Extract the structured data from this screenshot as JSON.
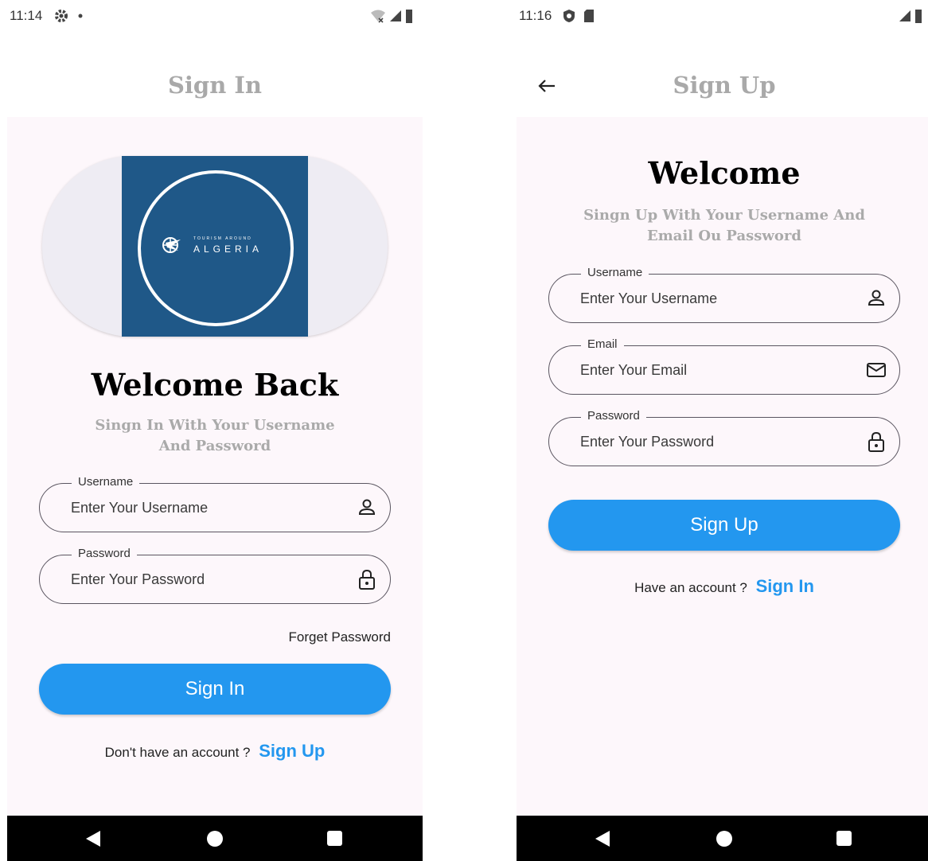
{
  "screens": {
    "signin": {
      "status_time": "11:14",
      "title": "Sign In",
      "logo": {
        "line1": "TOURISM AROUND",
        "line2": "ALGERIA"
      },
      "heading": "Welcome Back",
      "subheading": "Singn In With Your Username And Password",
      "fields": [
        {
          "label": "Username",
          "placeholder": "Enter Your Username",
          "icon": "person-icon"
        },
        {
          "label": "Password",
          "placeholder": "Enter Your Password",
          "icon": "lock-icon"
        }
      ],
      "forget_password": "Forget Password",
      "button": "Sign In",
      "footer_text": "Don't have an account ?",
      "footer_link": "Sign Up"
    },
    "signup": {
      "status_time": "11:16",
      "title": "Sign Up",
      "heading": "Welcome",
      "subheading": "Singn Up With Your Username And Email Ou Password",
      "fields": [
        {
          "label": "Username",
          "placeholder": "Enter Your Username",
          "icon": "person-icon"
        },
        {
          "label": "Email",
          "placeholder": "Enter Your Email",
          "icon": "mail-icon"
        },
        {
          "label": "Password",
          "placeholder": "Enter Your Password",
          "icon": "lock-icon"
        }
      ],
      "button": "Sign Up",
      "footer_text": "Have an account ?",
      "footer_link": "Sign In"
    }
  },
  "colors": {
    "primary": "#2397ef",
    "title_gray": "#a9a9a9",
    "content_bg": "#fdf7fb",
    "logo_blue": "#1f5888"
  }
}
